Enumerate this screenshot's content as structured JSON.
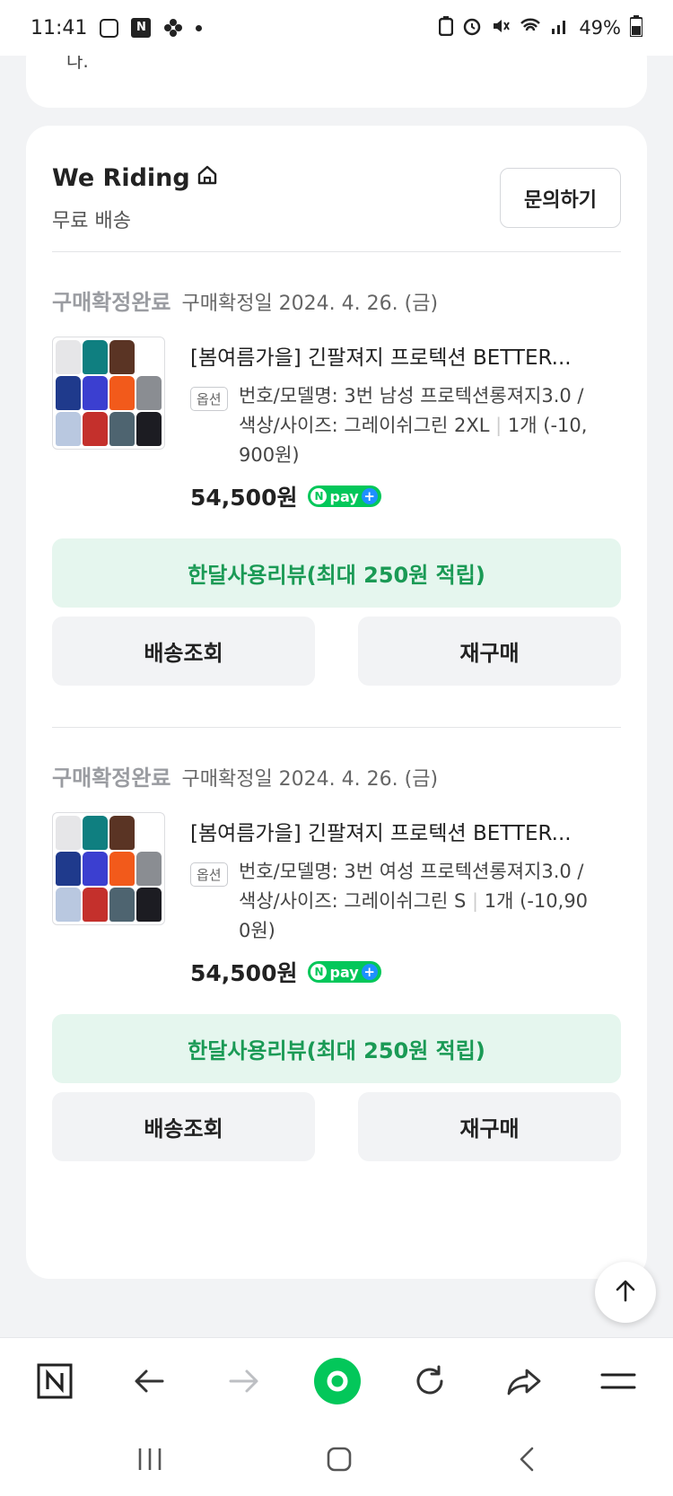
{
  "status_bar": {
    "time": "11:41",
    "battery": "49%"
  },
  "top_card": {
    "tail_text": "다."
  },
  "shop": {
    "name": "We Riding",
    "shipping": "무료 배송",
    "inquiry_label": "문의하기"
  },
  "orders": [
    {
      "status": "구매확정완료",
      "confirm_date": "구매확정일 2024. 4. 26. (금)",
      "title": "[봄여름가을] 긴팔져지 프로텍션 BETTER...",
      "option_badge": "옵션",
      "option_line1": "번호/모델명: 3번 남성 프로텍션롱져지3.0 /",
      "option_line2": "색상/사이즈: 그레이쉬그린 2XL",
      "option_qty": "1개 (-10,",
      "option_line3": "900원)",
      "price": "54,500원",
      "review_label": "한달사용리뷰(최대 250원 적립)",
      "track_label": "배송조회",
      "rebuy_label": "재구매"
    },
    {
      "status": "구매확정완료",
      "confirm_date": "구매확정일 2024. 4. 26. (금)",
      "title": "[봄여름가을] 긴팔져지 프로텍션 BETTER...",
      "option_badge": "옵션",
      "option_line1": "번호/모델명: 3번 여성 프로텍션롱져지3.0 /",
      "option_line2": "색상/사이즈: 그레이쉬그린 S",
      "option_qty": "1개 (-10,90",
      "option_line3": "0원)",
      "price": "54,500원",
      "review_label": "한달사용리뷰(최대 250원 적립)",
      "track_label": "배송조회",
      "rebuy_label": "재구매"
    }
  ],
  "npay": {
    "label": "pay"
  },
  "colors": {
    "accent_green": "#1a9a55",
    "review_bg": "#e5f6ee",
    "npay_green": "#03c75a",
    "thumb_jerseys": [
      "#e6e6e8",
      "#0f7f80",
      "#5a3424",
      "#ffffff",
      "#1f3a8c",
      "#3b3fd0",
      "#f25a1b",
      "#8a8d92",
      "#b9c8e0",
      "#c4302c",
      "#4e6470",
      "#1c1c22"
    ]
  },
  "icons": {
    "home": "home-icon",
    "scroll_top": "arrow-up-icon",
    "browser": [
      "naver-n-icon",
      "back-arrow-icon",
      "forward-arrow-icon",
      "green-home-dot-icon",
      "refresh-icon",
      "share-icon",
      "menu-icon"
    ],
    "system_nav": [
      "recent-apps-icon",
      "home-square-icon",
      "back-chevron-icon"
    ]
  }
}
